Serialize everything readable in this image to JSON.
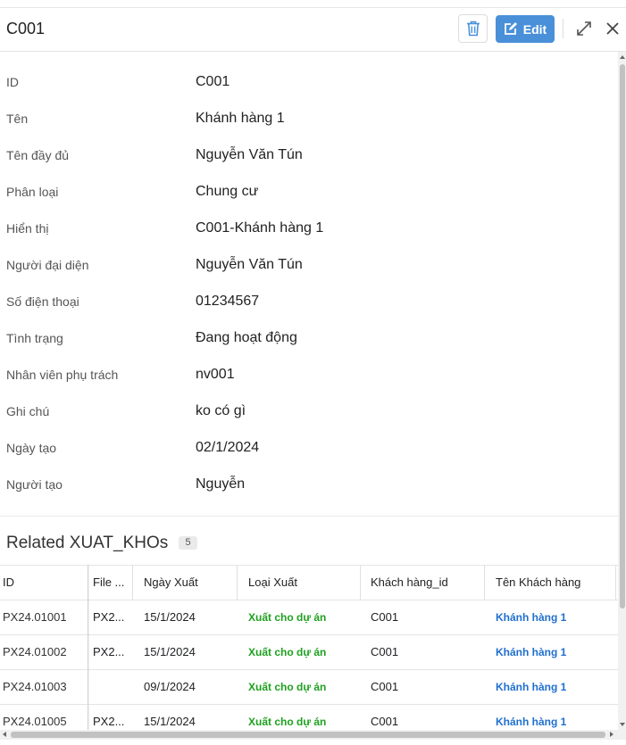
{
  "header": {
    "title": "C001",
    "edit_label": "Edit",
    "icons": {
      "delete": "trash-icon",
      "edit": "edit-icon",
      "expand": "expand-icon",
      "close": "close-icon"
    },
    "colors": {
      "edit_button": "#4a90d9",
      "delete_icon": "#4a90d9"
    }
  },
  "details": [
    {
      "label": "ID",
      "value": "C001"
    },
    {
      "label": "Tên",
      "value": "Khánh hàng 1"
    },
    {
      "label": "Tên đầy đủ",
      "value": "Nguyễn Văn Tún"
    },
    {
      "label": "Phân loại",
      "value": "Chung cư"
    },
    {
      "label": "Hiển thị",
      "value": "C001-Khánh hàng 1"
    },
    {
      "label": "Người đại diện",
      "value": "Nguyễn Văn Tún"
    },
    {
      "label": "Số điện thoại",
      "value": "01234567"
    },
    {
      "label": "Tình trạng",
      "value": "Đang hoạt động"
    },
    {
      "label": "Nhân viên phụ trách",
      "value": "nv001"
    },
    {
      "label": "Ghi chú",
      "value": "ko có gì"
    },
    {
      "label": "Ngày tạo",
      "value": "02/1/2024"
    },
    {
      "label": "Người tạo",
      "value": "Nguyễn"
    }
  ],
  "related": {
    "title": "Related XUAT_KHOs",
    "count": "5",
    "columns": [
      "ID",
      "File ...",
      "Ngày Xuất",
      "Loại Xuất",
      "Khách hàng_id",
      "Tên Khách hàng"
    ],
    "rows": [
      [
        "PX24.01001",
        "PX2...",
        "15/1/2024",
        "Xuất cho dự án",
        "C001",
        "Khánh hàng 1"
      ],
      [
        "PX24.01002",
        "PX2...",
        "15/1/2024",
        "Xuất cho dự án",
        "C001",
        "Khánh hàng 1"
      ],
      [
        "PX24.01003",
        "",
        "09/1/2024",
        "Xuất cho dự án",
        "C001",
        "Khánh hàng 1"
      ],
      [
        "PX24.01005",
        "PX2...",
        "15/1/2024",
        "Xuất cho dự án",
        "C001",
        "Khánh hàng 1"
      ]
    ],
    "colors": {
      "loai_xuat": "#20a020",
      "ten_khach_hang": "#1f6fcf"
    }
  }
}
